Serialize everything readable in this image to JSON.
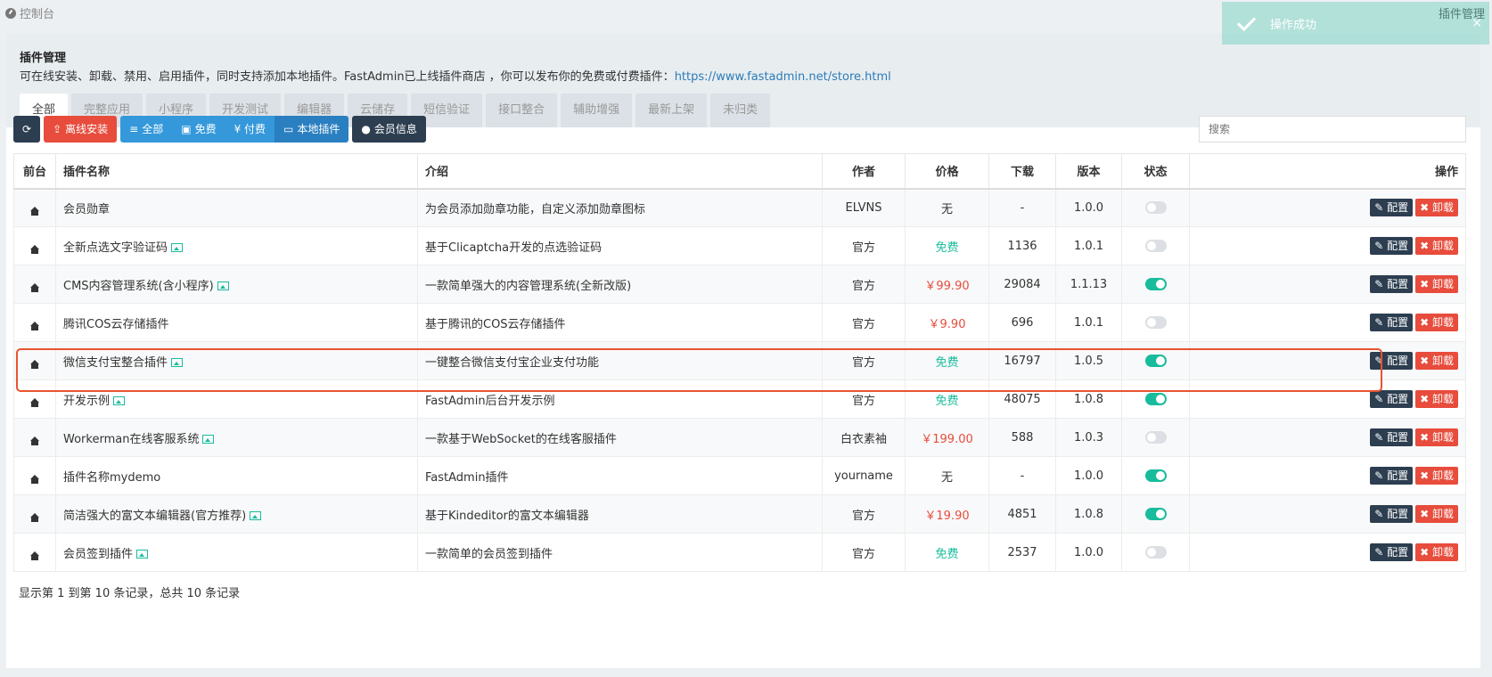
{
  "breadcrumb": {
    "label": "控制台",
    "right_label": "插件管理"
  },
  "toast": {
    "message": "操作成功",
    "close": "×"
  },
  "panel": {
    "title": "插件管理",
    "description": "可在线安装、卸载、禁用、启用插件，同时支持添加本地插件。FastAdmin已上线插件商店 ，你可以发布你的免费或付费插件：",
    "store_link": "https://www.fastadmin.net/store.html"
  },
  "tabs": [
    "全部",
    "完整应用",
    "小程序",
    "开发测试",
    "编辑器",
    "云储存",
    "短信验证",
    "接口整合",
    "辅助增强",
    "最新上架",
    "未归类"
  ],
  "toolbar": {
    "offline_install": "离线安装",
    "filter_all": "全部",
    "filter_free": "免费",
    "filter_paid": "¥ 付费",
    "local_plugins": "本地插件",
    "member_info": "会员信息",
    "search_placeholder": "搜索"
  },
  "table": {
    "headers": [
      "前台",
      "插件名称",
      "介绍",
      "作者",
      "价格",
      "下载",
      "版本",
      "状态",
      "操作"
    ],
    "config_label": "配置",
    "uninstall_label": "卸载",
    "rows": [
      {
        "name": "会员勋章",
        "has_image": false,
        "intro": "为会员添加勋章功能，自定义添加勋章图标",
        "author": "ELVNS",
        "price": "无",
        "price_type": "none",
        "downloads": "-",
        "version": "1.0.0",
        "enabled": false
      },
      {
        "name": "全新点选文字验证码",
        "has_image": true,
        "intro": "基于Clicaptcha开发的点选验证码",
        "author": "官方",
        "price": "免费",
        "price_type": "free",
        "downloads": "1136",
        "version": "1.0.1",
        "enabled": false
      },
      {
        "name": "CMS内容管理系统(含小程序)",
        "has_image": true,
        "intro": "一款简单强大的内容管理系统(全新改版)",
        "author": "官方",
        "price": "￥99.90",
        "price_type": "paid",
        "downloads": "29084",
        "version": "1.1.13",
        "enabled": true
      },
      {
        "name": "腾讯COS云存储插件",
        "has_image": false,
        "intro": "基于腾讯的COS云存储插件",
        "author": "官方",
        "price": "￥9.90",
        "price_type": "paid",
        "downloads": "696",
        "version": "1.0.1",
        "enabled": false
      },
      {
        "name": "微信支付宝整合插件",
        "has_image": true,
        "intro": "一键整合微信支付宝企业支付功能",
        "author": "官方",
        "price": "免费",
        "price_type": "free",
        "downloads": "16797",
        "version": "1.0.5",
        "enabled": true
      },
      {
        "name": "开发示例",
        "has_image": true,
        "intro": "FastAdmin后台开发示例",
        "author": "官方",
        "price": "免费",
        "price_type": "free",
        "downloads": "48075",
        "version": "1.0.8",
        "enabled": true
      },
      {
        "name": "Workerman在线客服系统",
        "has_image": true,
        "intro": "一款基于WebSocket的在线客服插件",
        "author": "白衣素袖",
        "price": "￥199.00",
        "price_type": "paid",
        "downloads": "588",
        "version": "1.0.3",
        "enabled": false
      },
      {
        "name": "插件名称mydemo",
        "has_image": false,
        "intro": "FastAdmin插件",
        "author": "yourname",
        "price": "无",
        "price_type": "none",
        "downloads": "-",
        "version": "1.0.0",
        "enabled": true
      },
      {
        "name": "简洁强大的富文本编辑器(官方推荐)",
        "has_image": true,
        "intro": "基于Kindeditor的富文本编辑器",
        "author": "官方",
        "price": "￥19.90",
        "price_type": "paid",
        "downloads": "4851",
        "version": "1.0.8",
        "enabled": true
      },
      {
        "name": "会员签到插件",
        "has_image": true,
        "intro": "一款简单的会员签到插件",
        "author": "官方",
        "price": "免费",
        "price_type": "free",
        "downloads": "2537",
        "version": "1.0.0",
        "enabled": false
      }
    ]
  },
  "pagination": {
    "summary": "显示第 1 到第 10 条记录，总共 10 条记录"
  },
  "colors": {
    "accent": "#18bc9c",
    "danger": "#e74c3c",
    "primary": "#3498db",
    "dark": "#2c3e50",
    "highlight": "#e8542f"
  }
}
